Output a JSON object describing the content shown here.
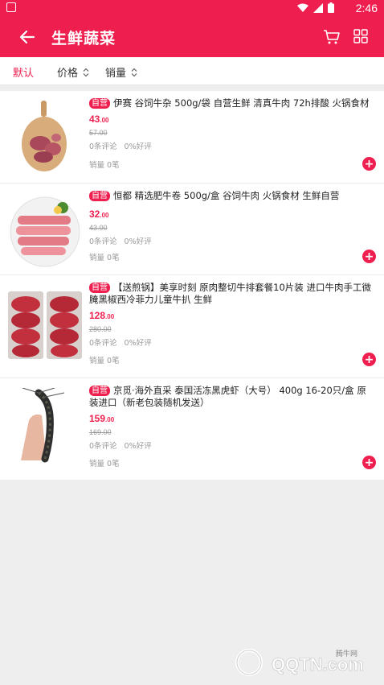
{
  "status_bar": {
    "time": "2:46"
  },
  "header": {
    "title": "生鲜蔬菜"
  },
  "sort_bar": {
    "default_label": "默认",
    "price_label": "价格",
    "sales_label": "销量"
  },
  "products": [
    {
      "badge": "自营",
      "name": "伊赛 谷饲牛杂 500g/袋 自营生鲜 清真牛肉 72h排酸 火锅食材",
      "price_int": "43",
      "price_dec": ".00",
      "original_price": "57.00",
      "reviews": "0条评论",
      "rating": "0%好评",
      "sales": "销量 0笔"
    },
    {
      "badge": "自营",
      "name": "恒都 精选肥牛卷 500g/盒 谷饲牛肉 火锅食材 生鲜自营",
      "price_int": "32",
      "price_dec": ".00",
      "original_price": "43.00",
      "reviews": "0条评论",
      "rating": "0%好评",
      "sales": "销量 0笔"
    },
    {
      "badge": "自营",
      "name": "【送煎锅】美享时刻 原肉整切牛排套餐10片装 进口牛肉手工微腌黑椒西冷菲力儿童牛扒 生鲜",
      "price_int": "128",
      "price_dec": ".00",
      "original_price": "280.00",
      "reviews": "0条评论",
      "rating": "0%好评",
      "sales": "销量 0笔"
    },
    {
      "badge": "自营",
      "name": "京觅·海外直采 泰国活冻黑虎虾（大号） 400g 16-20只/盒 原装进口（新老包装随机发送）",
      "price_int": "159",
      "price_dec": ".00",
      "original_price": "169.00",
      "reviews": "0条评论",
      "rating": "0%好评",
      "sales": "销量 0笔"
    }
  ],
  "watermark": {
    "brand": "QQTN.com",
    "cn": "腾牛网"
  },
  "colors": {
    "accent": "#ee1f4f",
    "muted": "#999999"
  }
}
